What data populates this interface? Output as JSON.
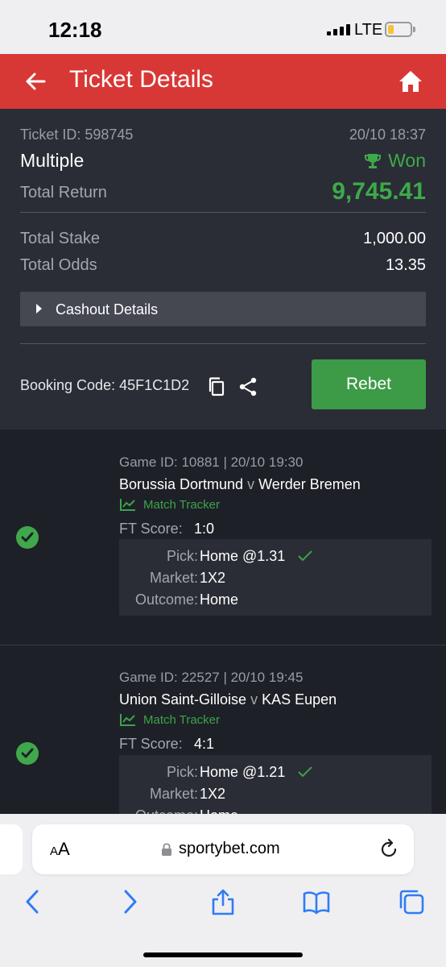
{
  "status_bar": {
    "time": "12:18",
    "network": "LTE"
  },
  "header": {
    "title": "Ticket Details"
  },
  "ticket": {
    "id_label": "Ticket ID: 598745",
    "date": "20/10 18:37",
    "type": "Multiple",
    "status": "Won",
    "total_return_label": "Total Return",
    "total_return": "9,745.41",
    "total_stake_label": "Total Stake",
    "total_stake": "1,000.00",
    "total_odds_label": "Total Odds",
    "total_odds": "13.35",
    "cashout_label": "Cashout Details",
    "booking_label": "Booking Code: 45F1C1D2",
    "rebet_label": "Rebet"
  },
  "selections": [
    {
      "game_id": "Game ID: 10881 | 20/10 19:30",
      "home": "Borussia Dortmund",
      "vs": "v",
      "away": "Werder Bremen",
      "tracker": "Match Tracker",
      "ft_label": "FT Score:",
      "ft_score": "1:0",
      "pick_label": "Pick:",
      "pick": "Home @1.31",
      "market_label": "Market:",
      "market": "1X2",
      "outcome_label": "Outcome:",
      "outcome": "Home"
    },
    {
      "game_id": "Game ID: 22527 | 20/10 19:45",
      "home": "Union Saint-Gilloise",
      "vs": "v",
      "away": "KAS Eupen",
      "tracker": "Match Tracker",
      "ft_label": "FT Score:",
      "ft_score": "4:1",
      "pick_label": "Pick:",
      "pick": "Home @1.21",
      "market_label": "Market:",
      "market": "1X2",
      "outcome_label": "Outcome:",
      "outcome": "Home"
    }
  ],
  "browser": {
    "text_size": "AA",
    "url": "sportybet.com"
  },
  "colors": {
    "brand_red": "#d83835",
    "won_green": "#3daa4a",
    "rebet_green": "#3d9b47",
    "ios_blue": "#2f7cf6"
  },
  "icons": [
    "back-arrow-icon",
    "home-icon",
    "trophy-icon",
    "caret-right-icon",
    "copy-icon",
    "share-icon",
    "check-circle-icon",
    "chart-line-icon",
    "checkmark-icon",
    "lock-icon",
    "reload-icon",
    "back-chevron-icon",
    "forward-chevron-icon",
    "share-box-icon",
    "book-icon",
    "tabs-icon"
  ]
}
